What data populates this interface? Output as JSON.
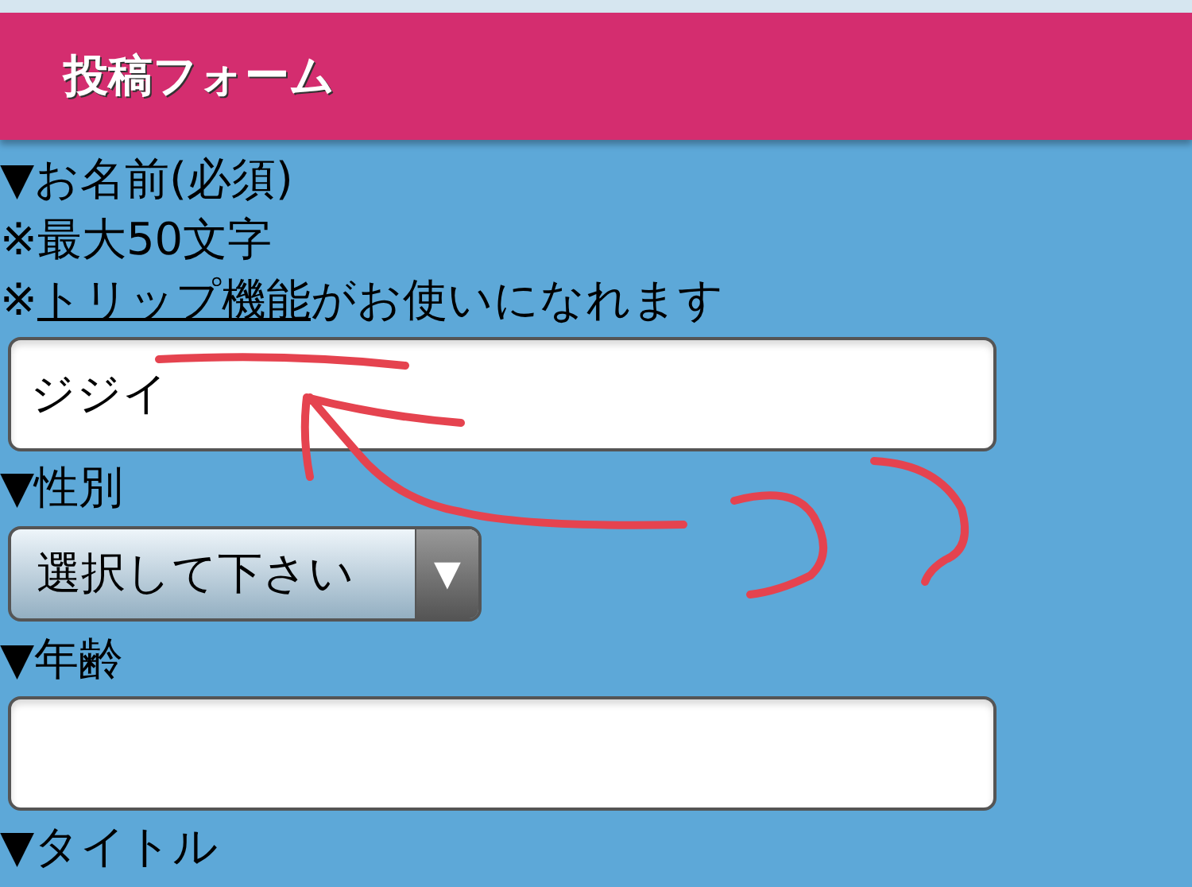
{
  "header": {
    "title": "投稿フォーム"
  },
  "items": [
    {
      "kind": "label",
      "text": "▼お名前(必須)"
    },
    {
      "kind": "note",
      "text": "※最大50文字"
    },
    {
      "kind": "note_link",
      "prefix": "※",
      "link": "トリップ機能",
      "suffix": "がお使いになれます"
    },
    {
      "kind": "input",
      "value": "ジジイ"
    },
    {
      "kind": "label",
      "text": "▼性別"
    },
    {
      "kind": "select",
      "value": "選択して下さい",
      "arrow": "▼"
    },
    {
      "kind": "label",
      "text": "▼年齢"
    },
    {
      "kind": "input"
    },
    {
      "kind": "label",
      "text": "▼タイトル"
    }
  ],
  "annotation": {
    "kind": "red_marks"
  }
}
